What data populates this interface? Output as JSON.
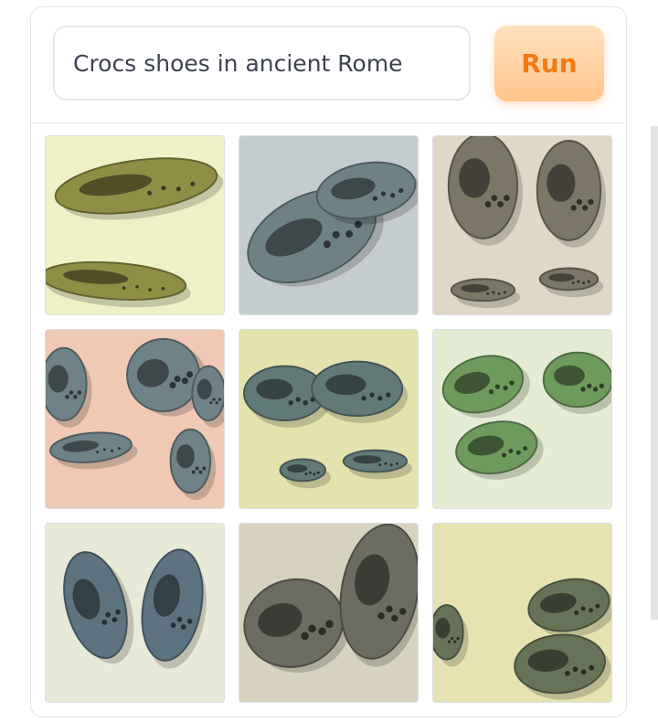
{
  "prompt": {
    "value": "Crocs shoes in ancient Rome"
  },
  "run_button": {
    "label": "Run",
    "accent": "#f07a14"
  },
  "results": [
    {
      "bg": "#eef0c8",
      "shoe": "#8f8e45"
    },
    {
      "bg": "#c5ccd0",
      "shoe": "#6e8286"
    },
    {
      "bg": "#e0d8c6",
      "shoe": "#7b7666"
    },
    {
      "bg": "#f0c9b4",
      "shoe": "#6f8288"
    },
    {
      "bg": "#e4e3ae",
      "shoe": "#617a78"
    },
    {
      "bg": "#e4ecd4",
      "shoe": "#6f9a5e"
    },
    {
      "bg": "#e8ead8",
      "shoe": "#5d7480"
    },
    {
      "bg": "#d6d2be",
      "shoe": "#6c6d60"
    },
    {
      "bg": "#e6e2b2",
      "shoe": "#677358"
    }
  ]
}
